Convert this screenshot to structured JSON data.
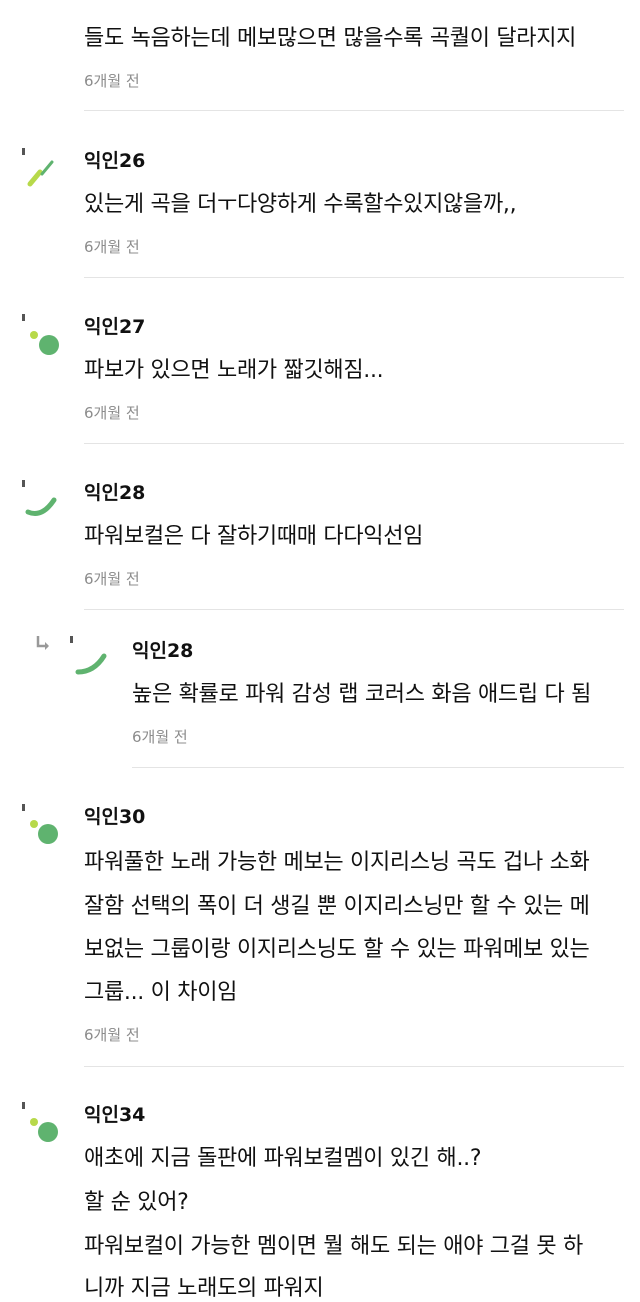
{
  "top": {
    "text": "들도 녹음하는데 메보많으면 많을수록 곡퀄이 달라지지",
    "time": "6개월 전"
  },
  "comments": [
    {
      "author": "익인26",
      "lines": [
        "있는게 곡을 더ㅜ다양하게 수록할수있지않을까,,"
      ],
      "time": "6개월 전",
      "avatar": "avatar-sticks-icon"
    },
    {
      "author": "익인27",
      "lines": [
        "파보가 있으면 노래가 짧깃해짐..."
      ],
      "time": "6개월 전",
      "avatar": "avatar-dots-icon"
    },
    {
      "author": "익인28",
      "lines": [
        "파워보컬은 다 잘하기때매 다다익선임"
      ],
      "time": "6개월 전",
      "avatar": "avatar-arc-icon"
    },
    {
      "author": "익인28",
      "lines": [
        "높은 확률로 파워 감성 랩 코러스 화음 애드립 다 됨"
      ],
      "time": "6개월 전",
      "avatar": "avatar-arc-icon",
      "reply": true
    },
    {
      "author": "익인30",
      "lines": [
        "파워풀한 노래 가능한 메보는 이지리스닝 곡도 겁나 소화",
        "잘함 선택의 폭이 더 생길 뿐 이지리스닝만 할 수 있는 메",
        "보없는 그룹이랑 이지리스닝도 할 수 있는 파워메보 있는",
        "그룹... 이 차이임"
      ],
      "time": "6개월 전",
      "avatar": "avatar-dots-icon"
    },
    {
      "author": "익인34",
      "lines": [
        "애초에 지금 돌판에 파워보컬멤이 있긴 해..?",
        "할 순 있어?",
        "파워보컬이 가능한 멤이면 뭘 해도 되는 애야 그걸 못 하",
        "니까 지금 노래도의 파워지"
      ],
      "avatar": "avatar-dots-icon"
    }
  ],
  "colors": {
    "green": "#5fb36f",
    "lime": "#b7d94a",
    "time": "#8c8c8c",
    "separator": "#e4e4e4"
  }
}
